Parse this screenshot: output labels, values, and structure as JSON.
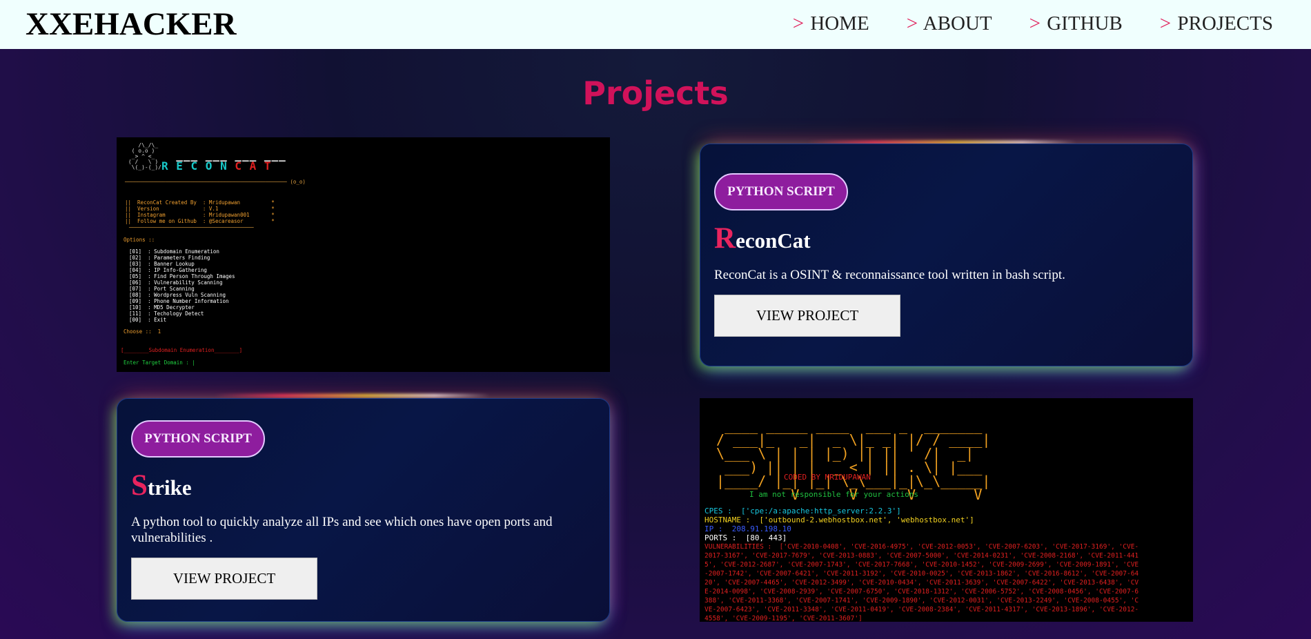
{
  "header": {
    "brand": "XXEHACKER",
    "nav_prefix": ">",
    "nav": [
      "HOME",
      "ABOUT",
      "GITHUB",
      "PROJECTS"
    ]
  },
  "page": {
    "title": "Projects"
  },
  "projects": [
    {
      "badge": "PYTHON SCRIPT",
      "title_first": "R",
      "title_rest": "econCat",
      "description": "ReconCat is a OSINT & reconnaissance tool written in bash script.",
      "button": "VIEW PROJECT"
    },
    {
      "badge": "PYTHON SCRIPT",
      "title_first": "S",
      "title_rest": "trike",
      "description": "A python tool to quickly analyze all IPs and see which ones have open ports and vulnerabilities .",
      "button": "VIEW PROJECT"
    }
  ],
  "reconcat_screenshot": {
    "info_lines": [
      "||  ReconCat Created By  : Mridupawan          *",
      "||  Version              : V.1                 *",
      "||  Instagram            : Mridupawan001       *",
      "||  Follow me on Github  : @Secareasor         *"
    ],
    "options_header": "Options ::",
    "options": [
      "[01]  : Subdomain Enumeration",
      "[02]  : Parameters Finding",
      "[03]  : Banner Lookup",
      "[04]  : IP Info-Gathering",
      "[05]  : Find Person Through Images",
      "[06]  : Vulnerability Scanning",
      "[07]  : Port Scanning",
      "[08]  : Wordpress Vuln Scanning",
      "[09]  : Phone Number Information",
      "[10]  : MD5 Decrypter",
      "[11]  : Techology Detect",
      "[00]  : Exit"
    ],
    "choose": "Choose ::  1",
    "section": "[________Subdomain Enumeration________]",
    "prompt": "Enter Target Domain : |"
  },
  "strike_screenshot": {
    "coded_by": "CODED BY MRIDUPAWAN",
    "disclaimer": "I am not responsible for your actions",
    "cpes": "CPES :  ['cpe:/a:apache:http_server:2.2.3']",
    "hostname": "HOSTNAME :  ['outbound-2.webhostbox.net', 'webhostbox.net']",
    "ip": "IP :  208.91.198.10",
    "ports": "PORTS :  [80, 443]",
    "vulnerabilities": [
      "VULNERABILITIES :  ['CVE-2010-0408', 'CVE-2016-4975', 'CVE-2012-0053', 'CVE-2007-6203', 'CVE-2017-3169', 'CVE-",
      "2017-3167', 'CVE-2017-7679', 'CVE-2013-0883', 'CVE-2007-5000', 'CVE-2014-0231', 'CVE-2008-2168', 'CVE-2011-441",
      "5', 'CVE-2012-2687', 'CVE-2007-1743', 'CVE-2017-7668', 'CVE-2010-1452', 'CVE-2009-2699', 'CVE-2009-1891', 'CVE",
      "-2007-1742', 'CVE-2007-6421', 'CVE-2011-3192', 'CVE-2010-0025', 'CVE-2013-1862', 'CVE-2016-8612', 'CVE-2007-64",
      "20', 'CVE-2007-4465', 'CVE-2012-3499', 'CVE-2010-0434', 'CVE-2011-3639', 'CVE-2007-6422', 'CVE-2013-6438', 'CV",
      "E-2014-0098', 'CVE-2008-2939', 'CVE-2007-6750', 'CVE-2018-1312', 'CVE-2006-5752', 'CVE-2008-0456', 'CVE-2007-6",
      "388', 'CVE-2011-3368', 'CVE-2007-1741', 'CVE-2009-1890', 'CVE-2012-0031', 'CVE-2013-2249', 'CVE-2008-0455', 'C",
      "VE-2007-6423', 'CVE-2011-3348', 'CVE-2011-0419', 'CVE-2008-2384', 'CVE-2011-4317', 'CVE-2013-1896', 'CVE-2012-",
      "4558', 'CVE-2009-1195', 'CVE-2011-3607']"
    ]
  }
}
